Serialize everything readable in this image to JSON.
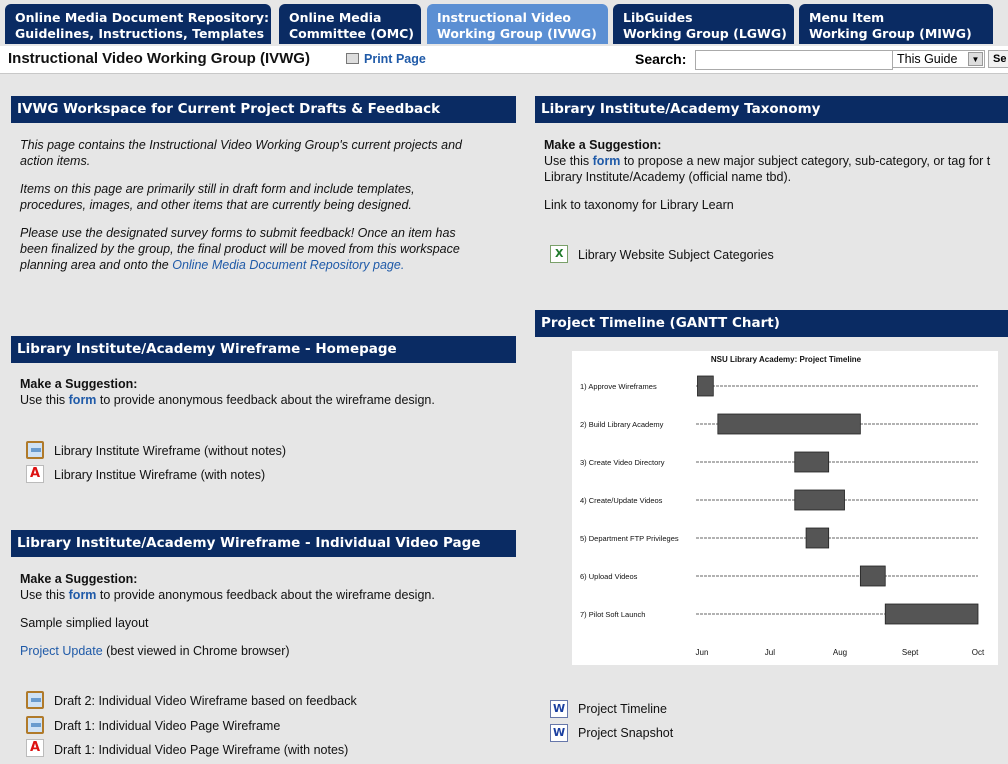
{
  "tabs": [
    {
      "line1": "Online Media Document Repository:",
      "line2": "Guidelines, Instructions, Templates"
    },
    {
      "line1": "Online Media",
      "line2": "Committee (OMC)"
    },
    {
      "line1": "Instructional Video",
      "line2": "Working Group (IVWG)"
    },
    {
      "line1": "LibGuides",
      "line2": "Working Group (LGWG)"
    },
    {
      "line1": "Menu Item",
      "line2": "Working Group (MIWG)"
    }
  ],
  "header": {
    "page_title": "Instructional Video Working Group (IVWG)",
    "print_label": "Print Page",
    "search_label": "Search:",
    "search_value": "",
    "scope_value": "This Guide",
    "search_button": "Se"
  },
  "box1": {
    "title": "IVWG Workspace for Current Project Drafts & Feedback",
    "p1a": "This page contains the Instructional Video Working Group's current projects and",
    "p1b": "action items.",
    "p2a": "Items on this page are primarily still in draft form and include templates,",
    "p2b": "procedures, images, and other items that are currently being designed.",
    "p3a": "Please use the designated survey forms to submit feedback!  Once an item has",
    "p3b": "been finalized by the group, the final product will be moved from this workspace",
    "p3c": "planning area and onto the ",
    "p3link": "Online Media Document Repository page."
  },
  "box2": {
    "title": "Library Institute/Academy Wireframe - Homepage",
    "suggest": "Make a Suggestion:",
    "use_a": "Use this ",
    "form": "form",
    "use_b": " to provide anonymous feedback about the wireframe design.",
    "link1": "Library Institute Wireframe (without notes)",
    "link2": "Library Institue Wireframe (with notes)"
  },
  "box3": {
    "title": "Library Institute/Academy Wireframe - Individual Video Page",
    "suggest": "Make a Suggestion:",
    "use_a": "Use this ",
    "form": "form",
    "use_b": " to provide anonymous feedback about the wireframe design.",
    "sample": "Sample simplied layout",
    "update": "Project Update",
    "update_note": " (best viewed in Chrome browser)",
    "link1": "Draft 2: Individual Video Wireframe based on feedback",
    "link2": "Draft 1: Individual Video Page Wireframe",
    "link3": "Draft 1: Individual Video Page Wireframe (with notes)"
  },
  "box4": {
    "title": "Library Institute/Academy Taxonomy",
    "suggest": "Make a Suggestion:",
    "use_a": "Use this ",
    "form": "form",
    "use_b": " to propose a new major subject category, sub-category, or tag for t",
    "use_c": "Library Institute/Academy (official name tbd).",
    "link_tax": "Link to taxonomy for Library Learn",
    "link_cat": "Library Website Subject Categories"
  },
  "box5": {
    "title": "Project Timeline (GANTT Chart)",
    "link1": "Project Timeline",
    "link2": "Project Snapshot"
  },
  "chart_data": {
    "type": "gantt",
    "title": "NSU Library Academy: Project Timeline",
    "x_ticks": [
      "Jun",
      "Jul",
      "Aug",
      "Sept",
      "Oct"
    ],
    "xlim": [
      "2014-06-01",
      "2014-10-01"
    ],
    "tasks": [
      {
        "label": "1)  Approve Wireframes",
        "start": "2014-05-30",
        "end": "2014-06-06"
      },
      {
        "label": "2)  Build Library Academy",
        "start": "2014-06-08",
        "end": "2014-08-10"
      },
      {
        "label": "3)  Create Video Directory",
        "start": "2014-07-12",
        "end": "2014-07-27"
      },
      {
        "label": "4)  Create/Update Videos",
        "start": "2014-07-12",
        "end": "2014-08-03"
      },
      {
        "label": "5)  Department FTP Privileges",
        "start": "2014-07-17",
        "end": "2014-07-27"
      },
      {
        "label": "6)  Upload Videos",
        "start": "2014-08-10",
        "end": "2014-08-21"
      },
      {
        "label": "7)  Pilot Soft Launch",
        "start": "2014-08-21",
        "end": "2014-10-01"
      }
    ],
    "bar_color": "#555555"
  }
}
